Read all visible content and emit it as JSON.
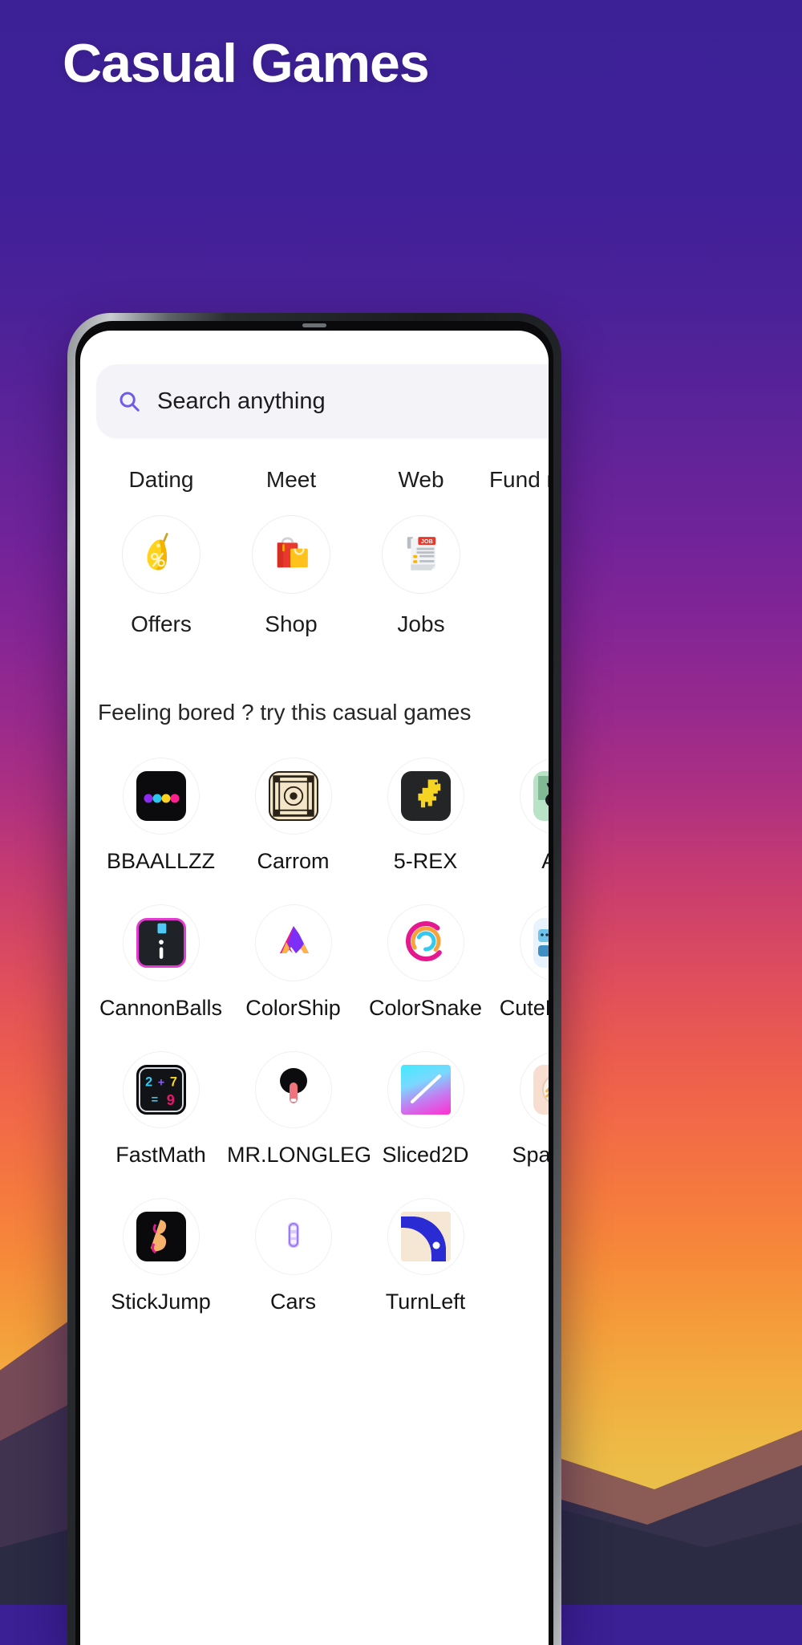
{
  "poster": {
    "headline": "Casual Games",
    "background_top_color": "#3c2196",
    "background_bottom_color": "#e2c953"
  },
  "phone": {
    "frame_color": "#1a1c1e",
    "screen_background": "#ffffff"
  },
  "app": {
    "search": {
      "placeholder": "Search anything",
      "icon": "search-icon",
      "icon_color": "#6c5ce7",
      "field_background": "#f4f4f8"
    },
    "category_tabs": [
      {
        "label": "Dating"
      },
      {
        "label": "Meet"
      },
      {
        "label": "Web"
      },
      {
        "label": "Fund raising"
      }
    ],
    "quick_actions": [
      {
        "label": "Offers",
        "icon": "discount-tag-icon"
      },
      {
        "label": "Shop",
        "icon": "shopping-bags-icon"
      },
      {
        "label": "Jobs",
        "icon": "job-listing-icon"
      }
    ],
    "section_heading": "Feeling bored ? try this casual games",
    "games": [
      {
        "label": "BBAALLZZ",
        "icon": "bbaallzz-icon"
      },
      {
        "label": "Carrom",
        "icon": "carrom-board-icon"
      },
      {
        "label": "5-REX",
        "icon": "dino-rex-icon"
      },
      {
        "label": "Ant",
        "icon": "ant-icon"
      },
      {
        "label": "CannonBalls",
        "icon": "cannonballs-icon"
      },
      {
        "label": "ColorShip",
        "icon": "colorship-icon"
      },
      {
        "label": "ColorSnake",
        "icon": "colorsnake-icon"
      },
      {
        "label": "CuteRunner",
        "icon": "cuterunner-icon"
      },
      {
        "label": "FastMath",
        "icon": "fastmath-icon"
      },
      {
        "label": "MR.LONGLEG",
        "icon": "mrlongleg-icon"
      },
      {
        "label": "Sliced2D",
        "icon": "sliced2d-icon"
      },
      {
        "label": "Spaghetti",
        "icon": "spaghetti-icon"
      },
      {
        "label": "StickJump",
        "icon": "stickjump-icon"
      },
      {
        "label": "Cars",
        "icon": "cars-icon"
      },
      {
        "label": "TurnLeft",
        "icon": "turnleft-icon"
      }
    ]
  }
}
